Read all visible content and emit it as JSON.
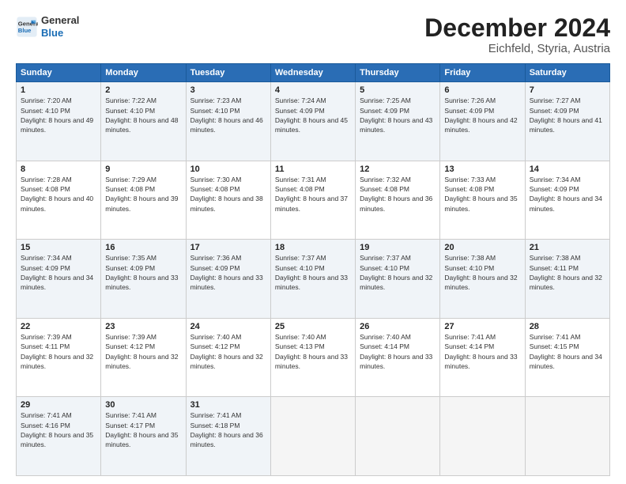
{
  "logo": {
    "line1": "General",
    "line2": "Blue"
  },
  "title": "December 2024",
  "subtitle": "Eichfeld, Styria, Austria",
  "weekdays": [
    "Sunday",
    "Monday",
    "Tuesday",
    "Wednesday",
    "Thursday",
    "Friday",
    "Saturday"
  ],
  "weeks": [
    [
      {
        "day": "1",
        "sunrise": "Sunrise: 7:20 AM",
        "sunset": "Sunset: 4:10 PM",
        "daylight": "Daylight: 8 hours and 49 minutes."
      },
      {
        "day": "2",
        "sunrise": "Sunrise: 7:22 AM",
        "sunset": "Sunset: 4:10 PM",
        "daylight": "Daylight: 8 hours and 48 minutes."
      },
      {
        "day": "3",
        "sunrise": "Sunrise: 7:23 AM",
        "sunset": "Sunset: 4:10 PM",
        "daylight": "Daylight: 8 hours and 46 minutes."
      },
      {
        "day": "4",
        "sunrise": "Sunrise: 7:24 AM",
        "sunset": "Sunset: 4:09 PM",
        "daylight": "Daylight: 8 hours and 45 minutes."
      },
      {
        "day": "5",
        "sunrise": "Sunrise: 7:25 AM",
        "sunset": "Sunset: 4:09 PM",
        "daylight": "Daylight: 8 hours and 43 minutes."
      },
      {
        "day": "6",
        "sunrise": "Sunrise: 7:26 AM",
        "sunset": "Sunset: 4:09 PM",
        "daylight": "Daylight: 8 hours and 42 minutes."
      },
      {
        "day": "7",
        "sunrise": "Sunrise: 7:27 AM",
        "sunset": "Sunset: 4:09 PM",
        "daylight": "Daylight: 8 hours and 41 minutes."
      }
    ],
    [
      {
        "day": "8",
        "sunrise": "Sunrise: 7:28 AM",
        "sunset": "Sunset: 4:08 PM",
        "daylight": "Daylight: 8 hours and 40 minutes."
      },
      {
        "day": "9",
        "sunrise": "Sunrise: 7:29 AM",
        "sunset": "Sunset: 4:08 PM",
        "daylight": "Daylight: 8 hours and 39 minutes."
      },
      {
        "day": "10",
        "sunrise": "Sunrise: 7:30 AM",
        "sunset": "Sunset: 4:08 PM",
        "daylight": "Daylight: 8 hours and 38 minutes."
      },
      {
        "day": "11",
        "sunrise": "Sunrise: 7:31 AM",
        "sunset": "Sunset: 4:08 PM",
        "daylight": "Daylight: 8 hours and 37 minutes."
      },
      {
        "day": "12",
        "sunrise": "Sunrise: 7:32 AM",
        "sunset": "Sunset: 4:08 PM",
        "daylight": "Daylight: 8 hours and 36 minutes."
      },
      {
        "day": "13",
        "sunrise": "Sunrise: 7:33 AM",
        "sunset": "Sunset: 4:08 PM",
        "daylight": "Daylight: 8 hours and 35 minutes."
      },
      {
        "day": "14",
        "sunrise": "Sunrise: 7:34 AM",
        "sunset": "Sunset: 4:09 PM",
        "daylight": "Daylight: 8 hours and 34 minutes."
      }
    ],
    [
      {
        "day": "15",
        "sunrise": "Sunrise: 7:34 AM",
        "sunset": "Sunset: 4:09 PM",
        "daylight": "Daylight: 8 hours and 34 minutes."
      },
      {
        "day": "16",
        "sunrise": "Sunrise: 7:35 AM",
        "sunset": "Sunset: 4:09 PM",
        "daylight": "Daylight: 8 hours and 33 minutes."
      },
      {
        "day": "17",
        "sunrise": "Sunrise: 7:36 AM",
        "sunset": "Sunset: 4:09 PM",
        "daylight": "Daylight: 8 hours and 33 minutes."
      },
      {
        "day": "18",
        "sunrise": "Sunrise: 7:37 AM",
        "sunset": "Sunset: 4:10 PM",
        "daylight": "Daylight: 8 hours and 33 minutes."
      },
      {
        "day": "19",
        "sunrise": "Sunrise: 7:37 AM",
        "sunset": "Sunset: 4:10 PM",
        "daylight": "Daylight: 8 hours and 32 minutes."
      },
      {
        "day": "20",
        "sunrise": "Sunrise: 7:38 AM",
        "sunset": "Sunset: 4:10 PM",
        "daylight": "Daylight: 8 hours and 32 minutes."
      },
      {
        "day": "21",
        "sunrise": "Sunrise: 7:38 AM",
        "sunset": "Sunset: 4:11 PM",
        "daylight": "Daylight: 8 hours and 32 minutes."
      }
    ],
    [
      {
        "day": "22",
        "sunrise": "Sunrise: 7:39 AM",
        "sunset": "Sunset: 4:11 PM",
        "daylight": "Daylight: 8 hours and 32 minutes."
      },
      {
        "day": "23",
        "sunrise": "Sunrise: 7:39 AM",
        "sunset": "Sunset: 4:12 PM",
        "daylight": "Daylight: 8 hours and 32 minutes."
      },
      {
        "day": "24",
        "sunrise": "Sunrise: 7:40 AM",
        "sunset": "Sunset: 4:12 PM",
        "daylight": "Daylight: 8 hours and 32 minutes."
      },
      {
        "day": "25",
        "sunrise": "Sunrise: 7:40 AM",
        "sunset": "Sunset: 4:13 PM",
        "daylight": "Daylight: 8 hours and 33 minutes."
      },
      {
        "day": "26",
        "sunrise": "Sunrise: 7:40 AM",
        "sunset": "Sunset: 4:14 PM",
        "daylight": "Daylight: 8 hours and 33 minutes."
      },
      {
        "day": "27",
        "sunrise": "Sunrise: 7:41 AM",
        "sunset": "Sunset: 4:14 PM",
        "daylight": "Daylight: 8 hours and 33 minutes."
      },
      {
        "day": "28",
        "sunrise": "Sunrise: 7:41 AM",
        "sunset": "Sunset: 4:15 PM",
        "daylight": "Daylight: 8 hours and 34 minutes."
      }
    ],
    [
      {
        "day": "29",
        "sunrise": "Sunrise: 7:41 AM",
        "sunset": "Sunset: 4:16 PM",
        "daylight": "Daylight: 8 hours and 35 minutes."
      },
      {
        "day": "30",
        "sunrise": "Sunrise: 7:41 AM",
        "sunset": "Sunset: 4:17 PM",
        "daylight": "Daylight: 8 hours and 35 minutes."
      },
      {
        "day": "31",
        "sunrise": "Sunrise: 7:41 AM",
        "sunset": "Sunset: 4:18 PM",
        "daylight": "Daylight: 8 hours and 36 minutes."
      },
      null,
      null,
      null,
      null
    ]
  ]
}
